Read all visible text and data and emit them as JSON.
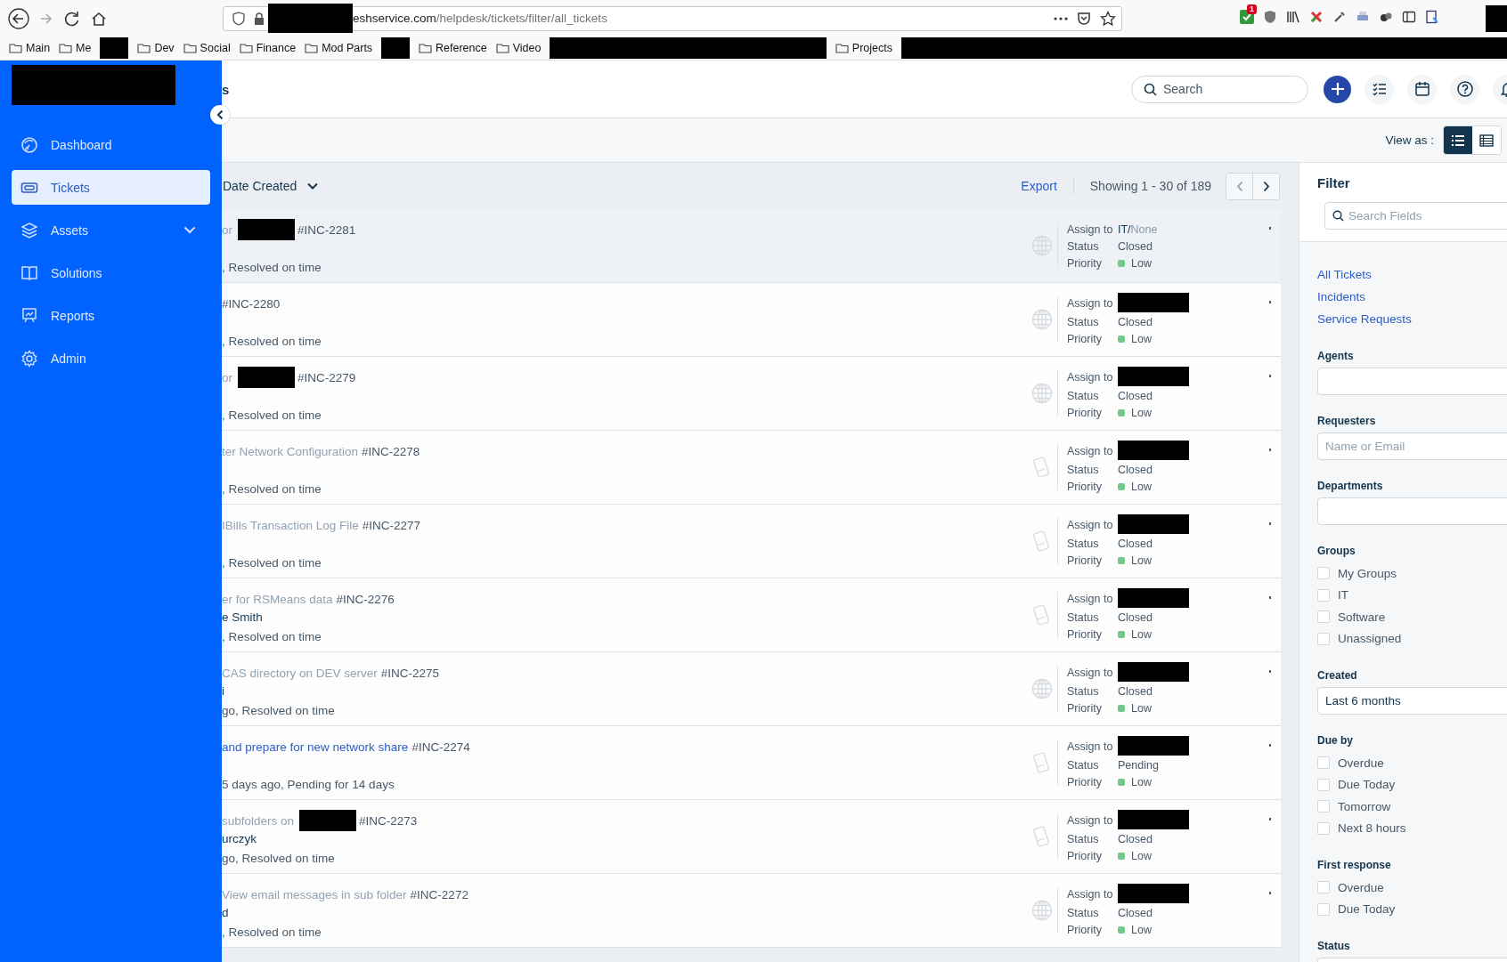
{
  "browser": {
    "host_redacted": true,
    "url_host": "eshservice.com",
    "url_path": "/helpdesk/tickets/filter/all_tickets",
    "extension_badge": "1",
    "bookmarks": [
      {
        "kind": "folder",
        "label": "Main"
      },
      {
        "kind": "folder",
        "label": "Me"
      },
      {
        "kind": "redacted"
      },
      {
        "kind": "folder",
        "label": "Dev"
      },
      {
        "kind": "folder",
        "label": "Social"
      },
      {
        "kind": "folder",
        "label": "Finance"
      },
      {
        "kind": "folder",
        "label": "Mod Parts"
      },
      {
        "kind": "redacted"
      },
      {
        "kind": "folder",
        "label": "Reference"
      },
      {
        "kind": "folder",
        "label": "Video"
      },
      {
        "kind": "redacted_long"
      },
      {
        "kind": "folder",
        "label": "Projects"
      },
      {
        "kind": "redacted_long"
      }
    ]
  },
  "sidebar": {
    "logo_redacted": true,
    "items": [
      {
        "label": "Dashboard",
        "selected": false,
        "expandable": false
      },
      {
        "label": "Tickets",
        "selected": true,
        "expandable": false
      },
      {
        "label": "Assets",
        "selected": false,
        "expandable": true
      },
      {
        "label": "Solutions",
        "selected": false,
        "expandable": false
      },
      {
        "label": "Reports",
        "selected": false,
        "expandable": false
      },
      {
        "label": "Admin",
        "selected": false,
        "expandable": false
      }
    ]
  },
  "header": {
    "title": "s",
    "search_placeholder": "Search"
  },
  "view_as": {
    "label": "View as :",
    "options": [
      {
        "selected": true
      },
      {
        "selected": false
      }
    ]
  },
  "list_header": {
    "sort": "Date Created",
    "export": "Export",
    "showing": "Showing 1 - 30 of 189"
  },
  "tickets": [
    {
      "selected": true,
      "highlighted": false,
      "kind": "web",
      "subject": "or",
      "subject_redacted": true,
      "id": "#INC-2281",
      "timeline": ", Resolved on time",
      "assign_label": "Assign to",
      "assignee_redacted": false,
      "assign_group": "IT/",
      "assign_agent": "None",
      "status_label": "Status",
      "status": "Closed",
      "priority_label": "Priority",
      "priority": "Low"
    },
    {
      "selected": false,
      "kind": "web",
      "subject_redacted": false,
      "id": "#INC-2280",
      "timeline": ", Resolved on time",
      "assign_label": "Assign to",
      "assignee_redacted": true,
      "status_label": "Status",
      "status": "Closed",
      "priority_label": "Priority",
      "priority": "Low"
    },
    {
      "selected": false,
      "highlighted": false,
      "kind": "web",
      "subject": "or",
      "subject_redacted": true,
      "id": "#INC-2279",
      "timeline": ", Resolved on time",
      "assign_label": "Assign to",
      "assignee_redacted": true,
      "status_label": "Status",
      "status": "Closed",
      "priority_label": "Priority",
      "priority": "Low"
    },
    {
      "selected": false,
      "highlighted": false,
      "kind": "phone",
      "subject": "ter Network Configuration",
      "subject_redacted": false,
      "id": "#INC-2278",
      "timeline": ", Resolved on time",
      "assign_label": "Assign to",
      "assignee_redacted": true,
      "status_label": "Status",
      "status": "Closed",
      "priority_label": "Priority",
      "priority": "Low"
    },
    {
      "selected": false,
      "highlighted": false,
      "kind": "phone",
      "subject": "IBills Transaction Log File",
      "subject_redacted": false,
      "id": "#INC-2277",
      "timeline": ", Resolved on time",
      "assign_label": "Assign to",
      "assignee_redacted": true,
      "status_label": "Status",
      "status": "Closed",
      "priority_label": "Priority",
      "priority": "Low"
    },
    {
      "selected": false,
      "highlighted": false,
      "kind": "phone",
      "subject": "er for RSMeans data",
      "subject_redacted": false,
      "id": "#INC-2276",
      "requester": "e Smith",
      "timeline": ", Resolved on time",
      "assign_label": "Assign to",
      "assignee_redacted": true,
      "status_label": "Status",
      "status": "Closed",
      "priority_label": "Priority",
      "priority": "Low"
    },
    {
      "selected": false,
      "highlighted": false,
      "kind": "web",
      "subject": "CAS directory on DEV server",
      "subject_redacted": false,
      "id": "#INC-2275",
      "requester": "i",
      "timeline": "go, Resolved on time",
      "assign_label": "Assign to",
      "assignee_redacted": true,
      "status_label": "Status",
      "status": "Closed",
      "priority_label": "Priority",
      "priority": "Low"
    },
    {
      "selected": false,
      "highlighted": true,
      "kind": "phone",
      "subject": "and prepare for new network share",
      "subject_redacted": false,
      "id": "#INC-2274",
      "timeline": "5 days ago, Pending for 14 days",
      "assign_label": "Assign to",
      "assignee_redacted": true,
      "status_label": "Status",
      "status": "Pending",
      "priority_label": "Priority",
      "priority": "Low"
    },
    {
      "selected": false,
      "highlighted": false,
      "kind": "phone",
      "subject": "subfolders on",
      "subject_redacted": true,
      "id": "#INC-2273",
      "requester": "urczyk",
      "timeline": "go, Resolved on time",
      "assign_label": "Assign to",
      "assignee_redacted": true,
      "status_label": "Status",
      "status": "Closed",
      "priority_label": "Priority",
      "priority": "Low"
    },
    {
      "selected": false,
      "highlighted": false,
      "kind": "web",
      "subject": "View email messages in sub folder",
      "subject_redacted": false,
      "id": "#INC-2272",
      "requester": "d",
      "timeline": ", Resolved on time",
      "assign_label": "Assign to",
      "assignee_redacted": true,
      "status_label": "Status",
      "status": "Closed",
      "priority_label": "Priority",
      "priority": "Low"
    }
  ],
  "filter": {
    "title": "Filter",
    "search_placeholder": "Search Fields",
    "links": [
      "All Tickets",
      "Incidents",
      "Service Requests"
    ],
    "sections": [
      {
        "kind": "field",
        "label": "Agents"
      },
      {
        "kind": "field",
        "label": "Requesters",
        "placeholder": "Name or Email"
      },
      {
        "kind": "field",
        "label": "Departments"
      },
      {
        "kind": "checks",
        "label": "Groups",
        "options": [
          {
            "label": "My Groups",
            "checked": false
          },
          {
            "label": "IT",
            "checked": false
          },
          {
            "label": "Software",
            "checked": false
          },
          {
            "label": "Unassigned",
            "checked": false
          }
        ]
      },
      {
        "kind": "field",
        "label": "Created",
        "value": "Last 6 months"
      },
      {
        "kind": "checks",
        "label": "Due by",
        "options": [
          {
            "label": "Overdue",
            "checked": false
          },
          {
            "label": "Due Today",
            "checked": false
          },
          {
            "label": "Tomorrow",
            "checked": false
          },
          {
            "label": "Next 8 hours",
            "checked": false
          }
        ]
      },
      {
        "kind": "checks",
        "label": "First response",
        "options": [
          {
            "label": "Overdue",
            "checked": false
          },
          {
            "label": "Due Today",
            "checked": false
          }
        ]
      },
      {
        "kind": "field",
        "label": "Status"
      }
    ]
  }
}
